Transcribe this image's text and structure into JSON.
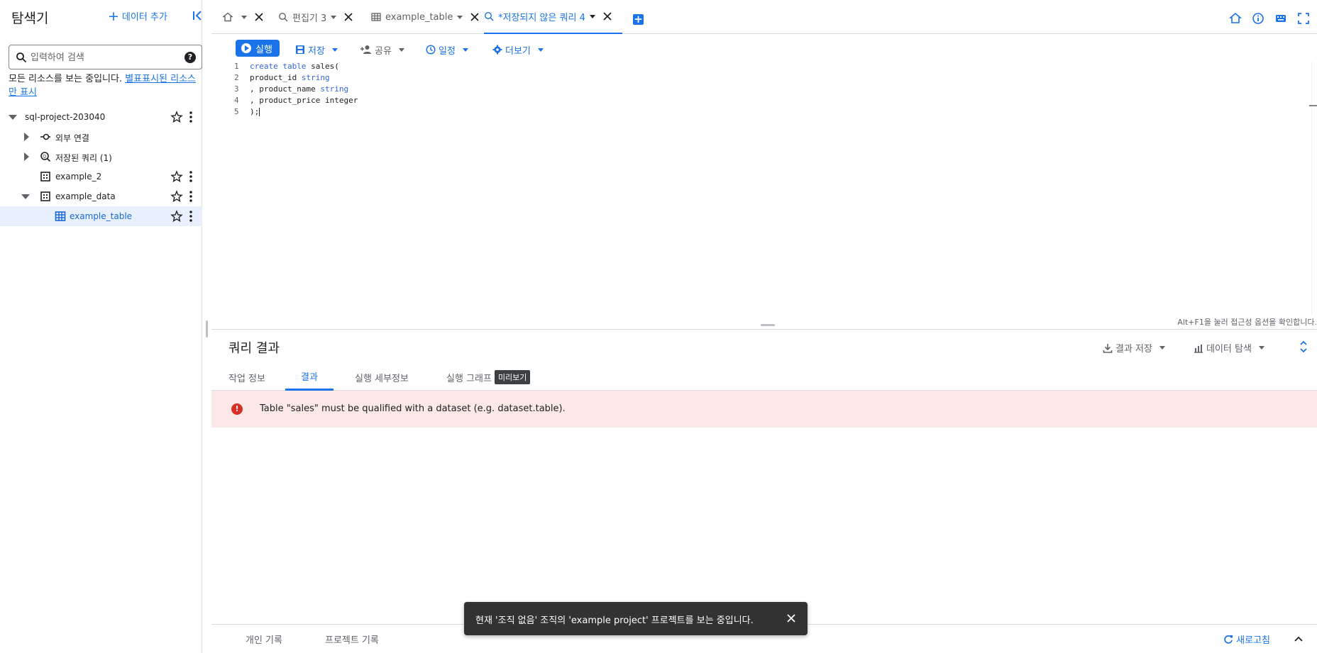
{
  "sidebar": {
    "title": "탐색기",
    "add_data_label": "데이터 추가",
    "search": {
      "placeholder": "입력하여 검색",
      "value": ""
    },
    "notice_text": "모든 리소스를 보는 중입니다.",
    "notice_link": "별표표시된 리소스만 표시",
    "tree": [
      {
        "label": "sql-project-203040",
        "icon": "caret-down"
      },
      {
        "label": "외부 연결",
        "icon": "connection-icon"
      },
      {
        "label": "저장된 쿼리 (1)",
        "icon": "saved-query-icon"
      },
      {
        "label": "example_2",
        "icon": "dataset-icon"
      },
      {
        "label": "example_data",
        "icon": "dataset-icon"
      },
      {
        "label": "example_table",
        "icon": "table-icon"
      }
    ]
  },
  "tabs": [
    {
      "label": "",
      "icon": "home-icon"
    },
    {
      "label": "편집기 3",
      "icon": "query-icon"
    },
    {
      "label": "example_table",
      "icon": "table-icon"
    },
    {
      "label": "*저장되지 않은 쿼리 4",
      "icon": "query-icon"
    }
  ],
  "toolbar": {
    "run_label": "실행",
    "save_label": "저장",
    "share_label": "공유",
    "schedule_label": "일정",
    "more_label": "더보기"
  },
  "editor": {
    "line_numbers": [
      "1",
      "2",
      "3",
      "4",
      "5"
    ],
    "a11y_hint": "Alt+F1을 눌러 접근성 옵션을 확인합니다."
  },
  "results": {
    "title": "쿼리 결과",
    "save_results_label": "결과 저장",
    "explore_data_label": "데이터 탐색",
    "tabs": [
      "작업 정보",
      "결과",
      "실행 세부정보",
      "실행 그래프"
    ],
    "preview_badge": "미리보기",
    "error_message": "Table \"sales\" must be qualified with a dataset (e.g. dataset.table)."
  },
  "history": {
    "personal_label": "개인 기록",
    "project_label": "프로젝트 기록",
    "refresh_label": "새로고침"
  },
  "snackbar": {
    "message": "현재 '조직 없음' 조직의 'example project' 프로젝트를 보는 중입니다."
  },
  "colors": {
    "accent": "#1a73e8",
    "error_bg": "#fce8e6",
    "error_icon": "#d93025",
    "selected_bg": "#e8f0fe"
  }
}
